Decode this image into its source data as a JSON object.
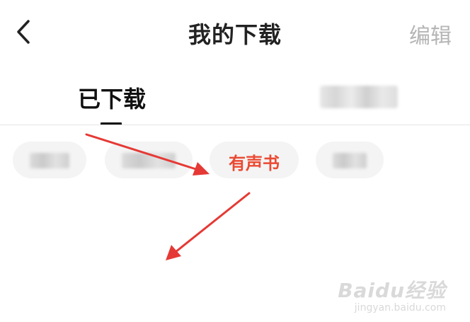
{
  "header": {
    "title": "我的下载",
    "edit_label": "编辑",
    "back_icon": "chevron-left-icon"
  },
  "tabs": [
    {
      "label": "已下载",
      "active": true
    },
    {
      "label": "",
      "active": false
    }
  ],
  "filter_chips": [
    {
      "label": "",
      "selected": false
    },
    {
      "label": "",
      "selected": false
    },
    {
      "label": "有声书",
      "selected": true
    },
    {
      "label": "",
      "selected": false
    }
  ],
  "colors": {
    "accent": "#ea4a33",
    "annotation_arrow": "#e53935",
    "edit_text": "#b5b5b5",
    "chip_bg": "#f4f4f4"
  },
  "watermark": {
    "logo": "Baidu经验",
    "url": "jingyan.baidu.com"
  }
}
